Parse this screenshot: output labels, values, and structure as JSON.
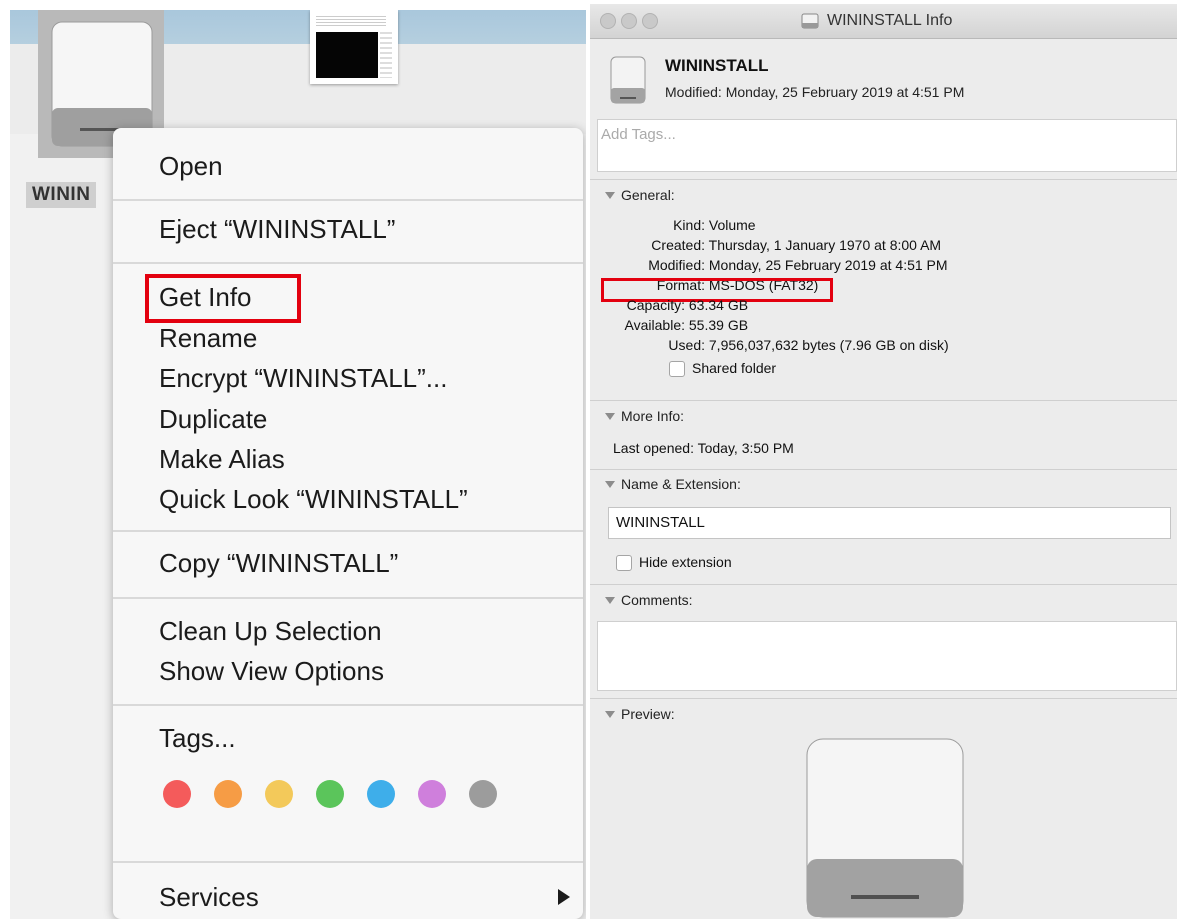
{
  "desktop": {
    "icon_label": "WININ"
  },
  "context_menu": {
    "items": [
      {
        "label": "Open"
      },
      {
        "label": "Eject “WININSTALL”"
      },
      {
        "label": "Get Info"
      },
      {
        "label": "Rename"
      },
      {
        "label": "Encrypt “WININSTALL”..."
      },
      {
        "label": "Duplicate"
      },
      {
        "label": "Make Alias"
      },
      {
        "label": "Quick Look “WININSTALL”"
      },
      {
        "label": "Copy “WININSTALL”"
      },
      {
        "label": "Clean Up Selection"
      },
      {
        "label": "Show View Options"
      },
      {
        "label": "Tags..."
      },
      {
        "label": "Services"
      }
    ],
    "tag_colors": [
      "#f45b5b",
      "#f69c45",
      "#f3c95a",
      "#5bc55b",
      "#3eaeea",
      "#cf7fdc",
      "#9c9c9c"
    ],
    "highlight_color": "#e3000f"
  },
  "info_window": {
    "title": "WININSTALL Info",
    "name": "WININSTALL",
    "modified_header": "Modified: Monday, 25 February 2019 at 4:51 PM",
    "tags_placeholder": "Add Tags...",
    "sections": {
      "general": "General:",
      "more_info": "More Info:",
      "name_ext": "Name & Extension:",
      "comments": "Comments:",
      "preview": "Preview:"
    },
    "general_rows": [
      {
        "key": "Kind:",
        "value": "Volume"
      },
      {
        "key": "Created:",
        "value": "Thursday, 1 January 1970 at 8:00 AM"
      },
      {
        "key": "Modified:",
        "value": "Monday, 25 February 2019 at 4:51 PM"
      },
      {
        "key": "Format:",
        "value": "MS-DOS (FAT32)"
      },
      {
        "key": "Capacity:",
        "value": "63.34 GB"
      },
      {
        "key": "Available:",
        "value": "55.39 GB"
      },
      {
        "key": "Used:",
        "value": "7,956,037,632 bytes (7.96 GB on disk)"
      }
    ],
    "shared_folder_label": "Shared folder",
    "last_opened": "Last opened: Today, 3:50 PM",
    "name_field_value": "WININSTALL",
    "hide_extension_label": "Hide extension"
  }
}
